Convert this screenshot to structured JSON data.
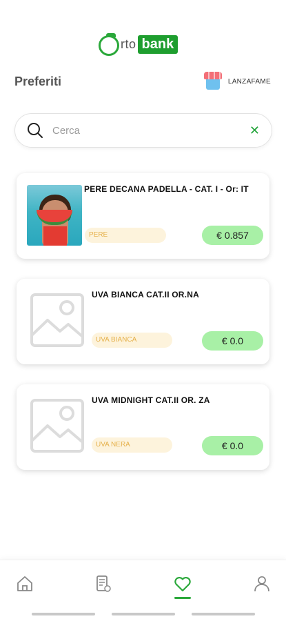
{
  "app": {
    "logo_prefix": "rto",
    "logo_word": "bank",
    "accent_color": "#2aa83a"
  },
  "header": {
    "title": "Preferiti",
    "store_name": "LANZAFAME",
    "store_icon": "store-icon"
  },
  "search": {
    "placeholder": "Cerca",
    "value": "",
    "clear_label": "✕"
  },
  "favorites": [
    {
      "name": "PERE DECANA PADELLA - CAT. I - Or: IT",
      "category": "PERE",
      "price": "€ 0.857",
      "image": "product-photo"
    },
    {
      "name": "UVA BIANCA CAT.II OR.NA",
      "category": "UVA BIANCA",
      "price": "€ 0.0",
      "image": "image-placeholder-icon"
    },
    {
      "name": "UVA MIDNIGHT CAT.II OR. ZA",
      "category": "UVA NERA",
      "price": "€ 0.0",
      "image": "image-placeholder-icon"
    }
  ],
  "bottom_nav": {
    "items": [
      "home-icon",
      "orders-icon",
      "heart-icon",
      "user-icon"
    ],
    "active": "heart-icon"
  }
}
